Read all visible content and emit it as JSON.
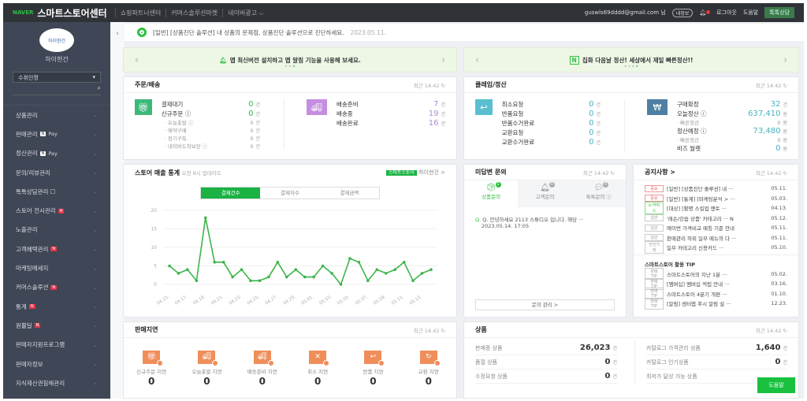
{
  "header": {
    "naver": "NAVER",
    "brand": "스마트스토어센터",
    "links": [
      "쇼핑파트너센터",
      "커머스솔루션마켓",
      "네이버광고 ⌵"
    ],
    "email": "guswls69dddd@gmail.com 님",
    "my_info": "내정보",
    "logout": "로그아웃",
    "help": "도움말",
    "talk": "톡톡상담"
  },
  "sidebar": {
    "store_name": "하이현건",
    "logo_text": "하이현건",
    "select": "수취인명",
    "items": [
      {
        "label": "상품관리"
      },
      {
        "label": "판매관리",
        "pay": "Pay"
      },
      {
        "label": "정산관리",
        "pay": "Pay"
      },
      {
        "label": "문의/리뷰관리"
      },
      {
        "label": "톡톡상담관리 ☐"
      },
      {
        "label": "스토어 전시관리",
        "n": "N"
      },
      {
        "label": "노출관리"
      },
      {
        "label": "고객혜택관리",
        "n": "N"
      },
      {
        "label": "마케팅메세지"
      },
      {
        "label": "커머스솔루션",
        "n": "N"
      },
      {
        "label": "통계",
        "n": "N"
      },
      {
        "label": "원쁠딜",
        "n": "N"
      },
      {
        "label": "판매자지원프로그램"
      },
      {
        "label": "판매자정보"
      },
      {
        "label": "지식재산권침해관리"
      }
    ]
  },
  "notice_bar": {
    "text": "[일반] [상품진단 솔루션] 내 상품의 문제점, 상품진단 솔루션으로 진단하세요.",
    "date": "2023.05.11."
  },
  "banners": [
    {
      "text": "앱 최신버전 설치하고 앱 알림 기능을 사용해 보세요."
    },
    {
      "text": "집화 다음날 정산! 세상에서 제일 빠른정산!!"
    }
  ],
  "time": "최근 14:42",
  "orders": {
    "title": "주문/배송",
    "left": [
      {
        "label": "결제대기",
        "value": "0",
        "unit": "건"
      },
      {
        "label": "신규주문 ⓘ",
        "value": "0",
        "unit": "건"
      }
    ],
    "left_sub": [
      {
        "label": "· 오늘출발 ⓘ",
        "value": "0",
        "unit": "건"
      },
      {
        "label": "· 예약구매",
        "value": "0",
        "unit": "건"
      },
      {
        "label": "· 정기구독",
        "value": "0",
        "unit": "건"
      },
      {
        "label": "· 네이버도착보장 ⓘ",
        "value": "0",
        "unit": "건"
      }
    ],
    "right": [
      {
        "label": "배송준비",
        "value": "7",
        "unit": "건"
      },
      {
        "label": "배송중",
        "value": "19",
        "unit": "건"
      },
      {
        "label": "배송완료",
        "value": "16",
        "unit": "건"
      }
    ]
  },
  "claims": {
    "title": "클레임/정산",
    "left": [
      {
        "label": "취소요청",
        "value": "0",
        "unit": "건"
      },
      {
        "label": "반품요청",
        "value": "0",
        "unit": "건"
      },
      {
        "label": "반품수거완료",
        "value": "0",
        "unit": "건"
      },
      {
        "label": "교환요청",
        "value": "0",
        "unit": "건"
      },
      {
        "label": "교환수거완료",
        "value": "0",
        "unit": "건"
      }
    ],
    "right": [
      {
        "label": "구매확정",
        "value": "32",
        "unit": "건",
        "sub": false
      },
      {
        "label": "오늘정산 ⓘ",
        "value": "637,410",
        "unit": "원",
        "sub": false
      },
      {
        "label": "· 빠른정산",
        "value": "0",
        "unit": "원",
        "sub": true
      },
      {
        "label": "정산예정 ⓘ",
        "value": "73,480",
        "unit": "원",
        "sub": false
      },
      {
        "label": "· 빠른정산",
        "value": "0",
        "unit": "원",
        "sub": true
      },
      {
        "label": "비즈 월렛",
        "value": "0",
        "unit": "원",
        "sub": false
      }
    ]
  },
  "sales": {
    "title": "스토어 매출 통계",
    "subtitle": "오전 8시 업데이트",
    "store_tag": "스마트스토어",
    "store_name": "하이현건 >",
    "tabs": [
      "결제건수",
      "결제자수",
      "결제금액"
    ]
  },
  "chart_data": {
    "type": "line",
    "x": [
      "04.15",
      "04.16",
      "04.17",
      "04.18",
      "04.19",
      "04.20",
      "04.21",
      "04.22",
      "04.23",
      "04.24",
      "04.25",
      "04.26",
      "04.27",
      "04.28",
      "04.29",
      "04.30",
      "05.01",
      "05.02",
      "05.03",
      "05.04",
      "05.05",
      "05.06",
      "05.07",
      "05.08",
      "05.09",
      "05.10",
      "05.11",
      "05.12",
      "05.13",
      "05.14"
    ],
    "values": [
      5,
      3,
      4,
      1,
      18,
      6,
      6,
      2,
      4,
      1,
      1,
      2,
      6,
      2,
      4,
      2,
      2,
      5,
      3,
      0,
      7,
      6,
      1,
      4,
      3,
      4,
      6,
      1,
      3,
      4
    ],
    "xticks": [
      "04.15.",
      "04.17.",
      "04.19.",
      "04.21.",
      "04.23.",
      "04.25.",
      "04.27.",
      "04.29.",
      "05.01.",
      "05.03.",
      "05.05.",
      "05.07.",
      "05.09.",
      "05.11.",
      "05.13."
    ],
    "yticks": [
      "0",
      "5",
      "10",
      "15",
      "20"
    ],
    "ylim": [
      0,
      20
    ],
    "grid": true,
    "color": "#3cb54a",
    "series_name": "결제건수"
  },
  "inquiry": {
    "title": "미답변 문의",
    "tabs": [
      {
        "label": "상품문의",
        "badge": "1"
      },
      {
        "label": "고객문의",
        "badge": "0"
      },
      {
        "label": "톡톡문의 ⓘ",
        "badge": "0"
      }
    ],
    "item": "Q. 안녕하세요 2113 스튜디오 입니다. 해당 ···",
    "item_date": "2023.05.14. 17:05",
    "button": "문의 관리 >"
  },
  "notices": {
    "title": "공지사항 >",
    "items": [
      {
        "tag": "중요",
        "t": "[일반] [상품진단 솔루션] 내 ···",
        "d": "05.11."
      },
      {
        "tag": "중요",
        "t": "[일반] [통계] [마케팅분석 > ···",
        "d": "05.03."
      },
      {
        "tag": "e-커머스",
        "t": "[대상] [활명 스킬업 멘토 ···",
        "d": "04.13."
      },
      {
        "tag": "일반",
        "t": "'레슨/강습 상품' 카테고리 ··· N",
        "d": "05.12."
      },
      {
        "tag": "일반",
        "t": "에이번 가격비교 매칭 기준 안내",
        "d": "05.11."
      },
      {
        "tag": "일반",
        "t": "판매관리 하위 일부 메뉴의 다 ···",
        "d": "05.11."
      },
      {
        "tag": "안전거래",
        "t": "일부 카테고리 신용카드 ···",
        "d": "05.10."
      }
    ],
    "tip_title": "스마트스토어 활용 TIP",
    "tips": [
      {
        "tag": "판매 TIP",
        "t": "스마트스토어의 지난 1분 ···",
        "d": "05.02."
      },
      {
        "tag": "판매 TIP",
        "t": "[멤버십] 멤버십 적립 안내 ···",
        "d": "03.16."
      },
      {
        "tag": "판매 TIP",
        "t": "스마트스토어 4분기 개편 ···",
        "d": "01.10."
      },
      {
        "tag": "판매 TIP",
        "t": "[알림] 센터앱 푸시 알림 설 ···",
        "d": "12.23."
      }
    ]
  },
  "delays": {
    "title": "판매지연",
    "items": [
      {
        "label": "신규주문 지연",
        "value": "0"
      },
      {
        "label": "오늘출발 지연",
        "value": "0"
      },
      {
        "label": "배송준비 지연",
        "value": "0"
      },
      {
        "label": "취소 지연",
        "value": "0"
      },
      {
        "label": "반품 지연",
        "value": "0"
      },
      {
        "label": "교환 지연",
        "value": "0"
      }
    ]
  },
  "products": {
    "title": "상품",
    "left": [
      {
        "label": "판매중 상품",
        "value": "26,023",
        "unit": "건"
      },
      {
        "label": "품절 상품",
        "value": "0",
        "unit": "건"
      },
      {
        "label": "수정요청 상품",
        "value": "0",
        "unit": "건"
      }
    ],
    "right": [
      {
        "label": "카탈로그 가격관리 상품",
        "value": "1,640",
        "unit": "건"
      },
      {
        "label": "카탈로그 인기상품",
        "value": "0",
        "unit": "건"
      },
      {
        "label": "최저가 달성 가능 상품",
        "value": "",
        "unit": ""
      }
    ],
    "help_button": "도움말"
  }
}
